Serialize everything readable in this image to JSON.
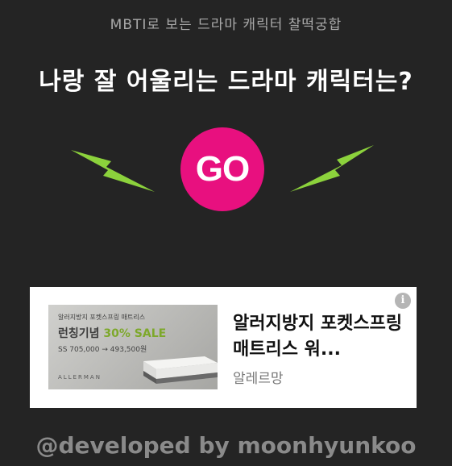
{
  "header": {
    "subtitle": "MBTI로 보는 드라마 캐릭터 찰떡궁합",
    "title": "나랑 잘 어울리는 드라마 캐릭터는?"
  },
  "main": {
    "go_label": "GO",
    "left_icon": "lightning-bolt-icon",
    "right_icon": "lightning-bolt-icon"
  },
  "ad": {
    "info_icon": "info-icon",
    "image_line1": "알러지방지 포켓스프링 매트리스",
    "image_line2_prefix": "런칭기념",
    "image_line2_accent": "30% SALE",
    "image_line3": "SS 705,000 → 493,500원",
    "image_brand": "ALLERMAN",
    "headline": "알러지방지 포켓스프링 매트리스 워...",
    "advertiser": "알레르망"
  },
  "footer": {
    "credit": "@developed by moonhyunkoo"
  },
  "colors": {
    "background": "#242424",
    "accent_pink": "#e8107f",
    "bolt_green": "#8cd23c"
  }
}
